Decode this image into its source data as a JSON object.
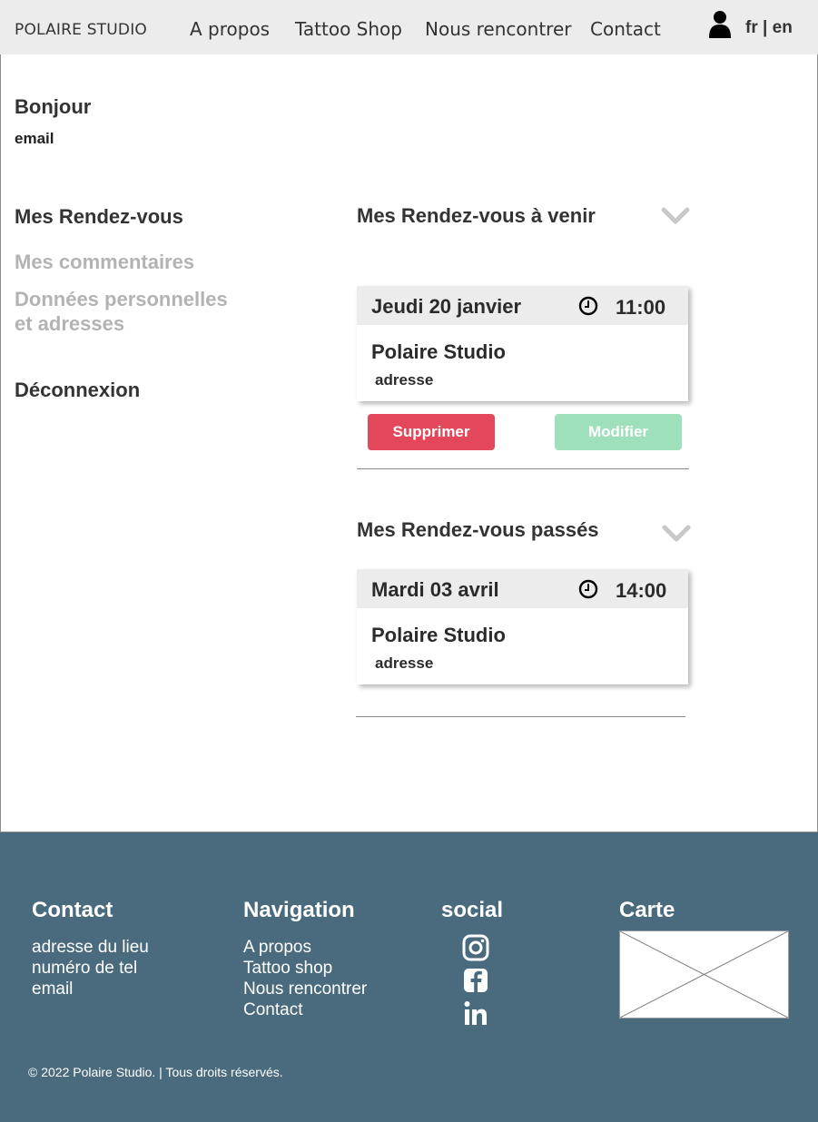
{
  "header": {
    "logo": "POLAIRE STUDIO",
    "nav": [
      {
        "label": "A propos"
      },
      {
        "label": "Tattoo Shop"
      },
      {
        "label": "Nous rencontrer"
      },
      {
        "label": "Contact"
      }
    ],
    "user_icon": "user-icon",
    "lang": {
      "fr": "fr",
      "separator": "|",
      "en": "en"
    }
  },
  "account": {
    "greeting": "Bonjour",
    "email": "email"
  },
  "sidebar": {
    "items": [
      {
        "label": "Mes Rendez-vous",
        "active": true
      },
      {
        "label": "Mes commentaires",
        "active": false
      },
      {
        "label_line1": "Données personnelles",
        "label_line2": "et adresses",
        "active": false
      },
      {
        "label": "Déconnexion",
        "active": true
      }
    ]
  },
  "upcoming": {
    "title": "Mes Rendez-vous à venir",
    "appointment": {
      "date": "Jeudi 20 janvier",
      "time": "11:00",
      "studio": "Polaire Studio",
      "address": "adresse"
    },
    "delete_label": "Supprimer",
    "edit_label": "Modifier"
  },
  "past": {
    "title": "Mes Rendez-vous passés",
    "appointment": {
      "date": "Mardi 03 avril",
      "time": "14:00",
      "studio": "Polaire Studio",
      "address": "adresse"
    }
  },
  "footer": {
    "contact": {
      "title": "Contact",
      "lines": [
        "adresse du lieu",
        "numéro de tel",
        "email"
      ]
    },
    "navigation": {
      "title": "Navigation",
      "links": [
        "A propos",
        "Tattoo shop",
        "Nous rencontrer",
        "Contact"
      ]
    },
    "social": {
      "title": "social",
      "icons": [
        "instagram-icon",
        "facebook-icon",
        "linkedin-icon"
      ]
    },
    "map": {
      "title": "Carte"
    },
    "copyright": "© 2022 Polaire Studio. | Tous droits réservés."
  },
  "colors": {
    "header_bg": "#ececec",
    "footer_bg": "#4a6b7d",
    "delete_button": "#e2485a",
    "edit_button": "#9ee0bb",
    "muted_text": "#b3b3b3"
  }
}
